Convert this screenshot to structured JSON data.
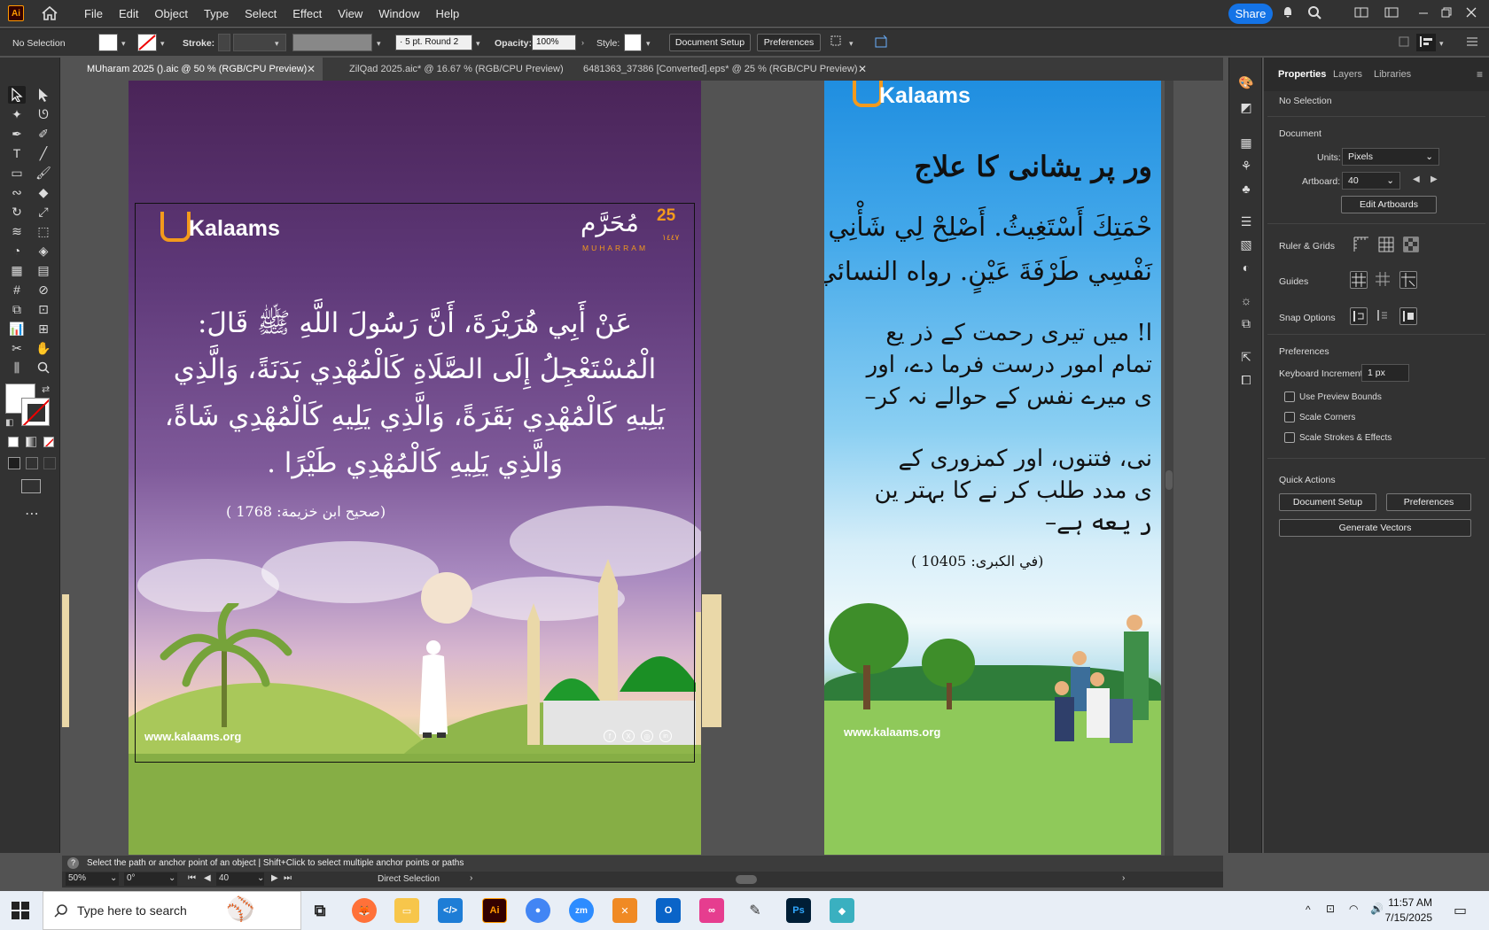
{
  "menubar": {
    "app_logo": "Ai",
    "items": [
      "File",
      "Edit",
      "Object",
      "Type",
      "Select",
      "Effect",
      "View",
      "Window",
      "Help"
    ],
    "share_label": "Share"
  },
  "controlbar": {
    "selection": "No Selection",
    "stroke_label": "Stroke:",
    "brush": "5 pt. Round 2",
    "opacity_label": "Opacity:",
    "opacity_value": "100%",
    "style_label": "Style:",
    "document_setup": "Document Setup",
    "preferences": "Preferences"
  },
  "tabs": [
    {
      "label": "MUharam 2025 ().aic @ 50 % (RGB/CPU Preview)",
      "active": true
    },
    {
      "label": "ZilQad 2025.aic* @ 16.67 % (RGB/CPU Preview)",
      "active": false
    },
    {
      "label": "6481363_37386 [Converted].eps* @ 25 % (RGB/CPU Preview)",
      "active": false
    }
  ],
  "artboard1": {
    "brand": "Kalaams",
    "date_number": "25",
    "date_arabic": "مُحَرَّم",
    "date_sub": "MUHARRAM",
    "date_year": "١٤٤٧",
    "hadith_lines": [
      "عَنْ أَبِي هُرَيْرَةَ، أَنَّ رَسُولَ اللَّهِ ﷺ قَالَ:",
      "الْمُسْتَعْجِلُ إِلَى الصَّلَاةِ كَالْمُهْدِي بَدَنَةً، وَالَّذِي",
      "يَلِيهِ كَالْمُهْدِي بَقَرَةً، وَالَّذِي يَلِيهِ كَالْمُهْدِي شَاةً،",
      "وَالَّذِي يَلِيهِ كَالْمُهْدِي طَيْرًا ."
    ],
    "reference": "(صحيح ابن خزيمة: 1768 )",
    "website": "www.kalaams.org"
  },
  "artboard2": {
    "brand": "Kalaams",
    "title": "ور پر یشانی کا علاج",
    "arabic_lines": [
      "حْمَتِكَ أَسْتَغِيثُ. أَصْلِحْ لِي شَأْنِي",
      "نَفْسِي طَرْفَةَ عَيْنٍ. رواه النسائي"
    ],
    "urdu_lines": [
      "ا! میں تیری رحمت کے ذر یع",
      "تمام امور درست فرما دے، اور",
      "ی میرے نفس کے حوالے نہ کر–",
      "نی، فتنوں، اور کمزوری کے",
      "ی مدد طلب کر نے کا بہتر ین",
      "ر یعه ہے–"
    ],
    "reference": "(في الكبرى: 10405 )",
    "website": "www.kalaams.org"
  },
  "properties": {
    "tabs": [
      "Properties",
      "Layers",
      "Libraries"
    ],
    "selection": "No Selection",
    "document_heading": "Document",
    "units_label": "Units:",
    "units_value": "Pixels",
    "artboard_label": "Artboard:",
    "artboard_value": "40",
    "edit_artboards": "Edit Artboards",
    "ruler_grids": "Ruler & Grids",
    "guides": "Guides",
    "snap_options": "Snap Options",
    "preferences_heading": "Preferences",
    "keyboard_increment_label": "Keyboard Increment:",
    "keyboard_increment_value": "1 px",
    "checkboxes": [
      "Use Preview Bounds",
      "Scale Corners",
      "Scale Strokes & Effects"
    ],
    "quick_actions": "Quick Actions",
    "document_setup": "Document Setup",
    "preferences": "Preferences",
    "generate_vectors": "Generate Vectors"
  },
  "status": {
    "hint": "Select the path or anchor point of an object  |  Shift+Click to select multiple anchor points or paths",
    "zoom": "50%",
    "rotation": "0°",
    "artboard": "40",
    "tool": "Direct Selection"
  },
  "taskbar": {
    "search_placeholder": "Type here to search",
    "time": "11:57 AM",
    "date": "7/15/2025"
  },
  "colors": {
    "accent": "#1473e6",
    "ai_orange": "#ff9a00",
    "brand_orange": "#f39a1c"
  }
}
